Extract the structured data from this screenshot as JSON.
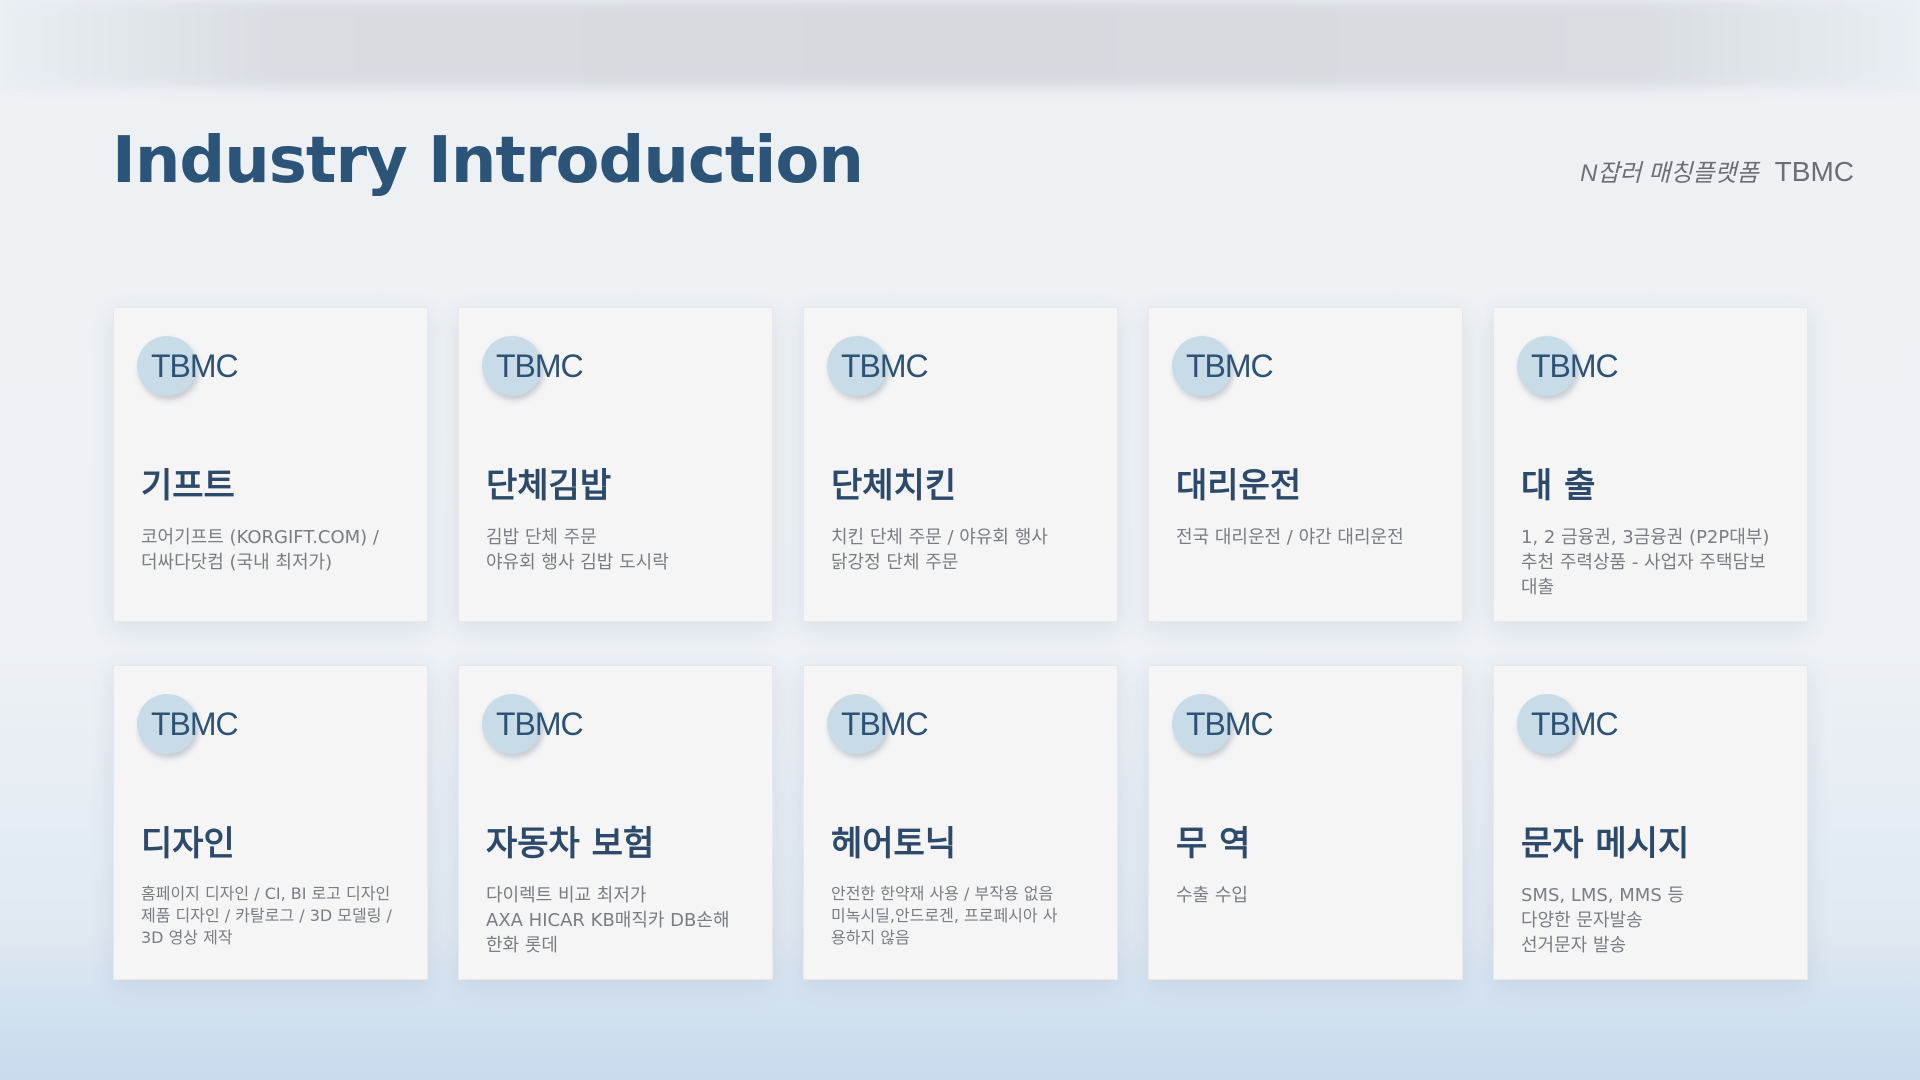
{
  "page": {
    "title": "Industry Introduction",
    "brand_tagline": "N잡러 매칭플랫폼",
    "brand_name": "TBMC"
  },
  "colors": {
    "title": "#2c5479",
    "card_heading": "#2d4a6a",
    "logo_circle": "#c8dce7",
    "card_background": "#f5f5f6",
    "description_text": "#7a7d82"
  },
  "cards": [
    {
      "logo": "TBMC",
      "title": "기프트",
      "lines": [
        "코어기프트 (KORGIFT.COM) /",
        "더싸다닷컴 (국내 최저가)"
      ]
    },
    {
      "logo": "TBMC",
      "title": "단체김밥",
      "lines": [
        "김밥 단체 주문",
        "야유회 행사  김밥 도시락"
      ]
    },
    {
      "logo": "TBMC",
      "title": "단체치킨",
      "lines": [
        "치킨 단체 주문 / 야유회 행사",
        " 닭강정 단체 주문"
      ]
    },
    {
      "logo": "TBMC",
      "title": "대리운전",
      "lines": [
        "전국 대리운전 / 야간 대리운전"
      ]
    },
    {
      "logo": "TBMC",
      "title": "대 출",
      "lines": [
        "1, 2 금융권, 3금융권 (P2P대부)",
        "추천 주력상품 - 사업자 주택담보",
        "대출"
      ]
    },
    {
      "logo": "TBMC",
      "title": "디자인",
      "lines": [
        "홈페이지 디자인  / CI, BI 로고 디자인",
        "제품 디자인 / 카탈로그 / 3D 모델링 /",
        "3D 영상 제작"
      ]
    },
    {
      "logo": "TBMC",
      "title": "자동차 보험",
      "lines": [
        "다이렉트 비교 최저가",
        "AXA HICAR KB매직카 DB손해",
        "한화 롯데"
      ]
    },
    {
      "logo": "TBMC",
      "title": "헤어토닉",
      "lines": [
        "안전한 한약재 사용 / 부작용 없음",
        "미녹시딜,안드로겐, 프로페시아 사",
        "용하지 않음"
      ]
    },
    {
      "logo": "TBMC",
      "title": "무 역",
      "lines": [
        "수출 수입"
      ]
    },
    {
      "logo": "TBMC",
      "title": "문자 메시지",
      "lines": [
        "SMS, LMS, MMS 등",
        "다양한 문자발송",
        "선거문자 발송"
      ]
    }
  ]
}
